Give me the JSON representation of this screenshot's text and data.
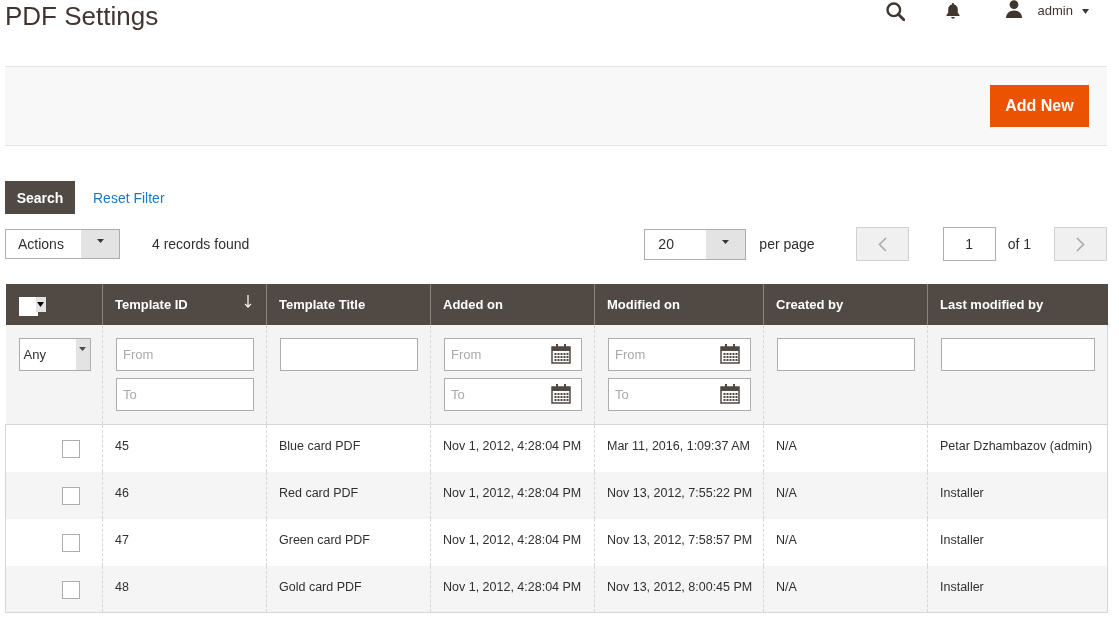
{
  "page": {
    "title": "PDF Settings"
  },
  "header": {
    "user": "admin"
  },
  "action_bar": {
    "add_button": "Add New"
  },
  "filter_actions": {
    "search_button": "Search",
    "reset_link": "Reset Filter"
  },
  "toolbar": {
    "mass_actions": {
      "value": "Actions"
    },
    "records_found": "4 records found",
    "per_page": {
      "value": "20",
      "label": "per page"
    },
    "pager": {
      "previous": {
        "disabled": true
      },
      "page": "1",
      "total": "of 1",
      "next": {
        "disabled": true
      }
    }
  },
  "table": {
    "mass_select": {
      "checked": false
    },
    "mass_filter": {
      "value": "Any"
    },
    "columns": [
      {
        "label": "Template ID",
        "sorted": true,
        "filter": {
          "kind": "range",
          "fields": [
            {
              "placeholder": "From"
            },
            {
              "placeholder": "To"
            }
          ]
        }
      },
      {
        "label": "Template Title",
        "sorted": false,
        "filter": {
          "kind": "text"
        }
      },
      {
        "label": "Added on",
        "sorted": false,
        "filter": {
          "kind": "date_range",
          "fields": [
            {
              "placeholder": "From"
            },
            {
              "placeholder": "To"
            }
          ]
        }
      },
      {
        "label": "Modified on",
        "sorted": false,
        "filter": {
          "kind": "date_range",
          "fields": [
            {
              "placeholder": "From"
            },
            {
              "placeholder": "To"
            }
          ]
        }
      },
      {
        "label": "Created by",
        "sorted": false,
        "filter": {
          "kind": "text"
        }
      },
      {
        "label": "Last modified by",
        "sorted": false,
        "filter": {
          "kind": "text"
        }
      }
    ],
    "rows": [
      {
        "checked": false,
        "cells": [
          "45",
          "Blue card PDF",
          "Nov 1, 2012, 4:28:04 PM",
          "Mar 11, 2016, 1:09:37 AM",
          "N/A",
          "Petar Dzhambazov (admin)"
        ]
      },
      {
        "checked": false,
        "cells": [
          "46",
          "Red card PDF",
          "Nov 1, 2012, 4:28:04 PM",
          "Nov 13, 2012, 7:55:22 PM",
          "N/A",
          "Installer"
        ]
      },
      {
        "checked": false,
        "cells": [
          "47",
          "Green card PDF",
          "Nov 1, 2012, 4:28:04 PM",
          "Nov 13, 2012, 7:58:57 PM",
          "N/A",
          "Installer"
        ]
      },
      {
        "checked": false,
        "cells": [
          "48",
          "Gold card PDF",
          "Nov 1, 2012, 4:28:04 PM",
          "Nov 13, 2012, 8:00:45 PM",
          "N/A",
          "Installer"
        ]
      }
    ]
  }
}
